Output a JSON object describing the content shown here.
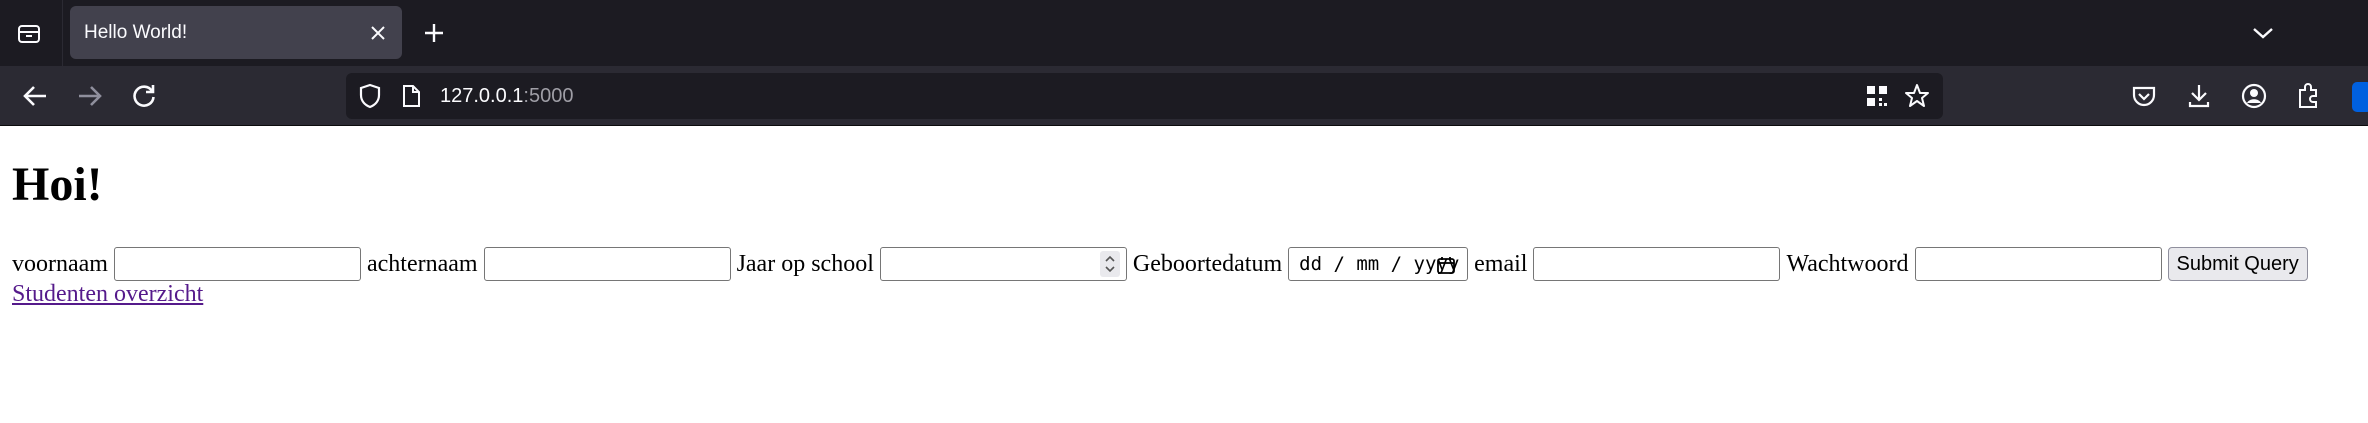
{
  "browser": {
    "tab": {
      "title": "Hello World!"
    },
    "urlbar": {
      "host": "127.0.0.1",
      "port": ":5000"
    },
    "icons": {
      "tab_list": "tab-list-icon",
      "tab_close": "close-icon",
      "new_tab": "plus-icon",
      "tab_overflow": "chevron-down-icon",
      "back": "back-arrow-icon",
      "forward": "forward-arrow-icon",
      "reload": "reload-icon",
      "shield": "tracking-protection-shield-icon",
      "page": "page-icon",
      "qr": "qr-code-icon",
      "bookmark": "star-icon",
      "pocket": "pocket-icon",
      "downloads": "download-icon",
      "account": "account-icon",
      "extensions": "extensions-icon",
      "bitwarden": "bitwarden-icon"
    },
    "colors": {
      "tabbar": "#1c1b22",
      "navbar": "#2b2a33",
      "active_tab": "#42414d"
    }
  },
  "page": {
    "title": "Hoi!",
    "form": {
      "fields": [
        {
          "label": "voornaam",
          "value": ""
        },
        {
          "label": "achternaam",
          "value": ""
        },
        {
          "label": "Jaar op school",
          "value": ""
        },
        {
          "label": "Geboortedatum",
          "placeholder": "dd / mm / yyyy"
        },
        {
          "label": "email",
          "value": ""
        },
        {
          "label": "Wachtwoord",
          "value": ""
        }
      ],
      "submit_label": "Submit Query"
    },
    "link": {
      "label": "Studenten overzicht",
      "color": "#551a8b"
    }
  }
}
